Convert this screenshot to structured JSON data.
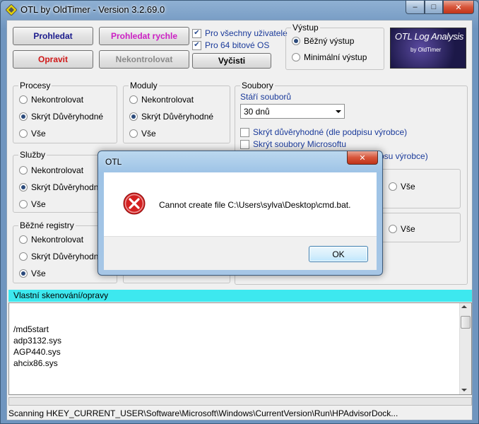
{
  "window": {
    "title": "OTL by OldTimer - Version 3.2.69.0",
    "minimize_glyph": "–",
    "maximize_glyph": "□",
    "close_glyph": "✕"
  },
  "toolbar": {
    "scan_label": "Prohledat",
    "quick_scan_label": "Prohledat rychle",
    "fix_label": "Opravit",
    "unchecked_label": "Nekontrolovat",
    "clear_label": "Vyčisti",
    "all_users_label": "Pro všechny uživatele",
    "bit64_label": "Pro 64 bitové OS"
  },
  "output": {
    "group_label": "Výstup",
    "standard_label": "Běžný výstup",
    "minimal_label": "Minimální výstup"
  },
  "logo": {
    "title": "OTL Log Analysis",
    "subtitle": "by OldTimer"
  },
  "groups": {
    "processes": {
      "label": "Procesy"
    },
    "modules": {
      "label": "Moduly"
    },
    "services": {
      "label": "Služby"
    },
    "registry": {
      "label": "Běžné registry"
    },
    "files": {
      "label": "Soubory"
    }
  },
  "options": {
    "unchecked": "Nekontrolovat",
    "hide_trusted": "Skrýt Důvěryhodné",
    "all": "Vše"
  },
  "files": {
    "age_label": "Stáří souborů",
    "age_value": "30 dnů",
    "hide_trusted_sig": "Skrýt důvěryhodné (dle podpisu výrobce)",
    "hide_microsoft": "Skrýt soubory Microsoftu",
    "partial_hidden_text": "psu výrobce)"
  },
  "custom_scan": {
    "header": "Vlastní skenování/opravy",
    "lines": [
      "/md5start",
      "adp3132.sys",
      "AGP440.sys",
      "ahcix86.sys"
    ]
  },
  "status_text": "Scanning HKEY_CURRENT_USER\\Software\\Microsoft\\Windows\\CurrentVersion\\Run\\HPAdvisorDock...",
  "dialog": {
    "title": "OTL",
    "message": "Cannot create file C:\\Users\\sylva\\Desktop\\cmd.bat.",
    "ok_label": "OK",
    "close_glyph": "✕"
  },
  "colors": {
    "scan_button_text": "#1a1a8c",
    "quick_scan_button_text": "#cc1fc4",
    "fix_button_text": "#d01818",
    "disabled_text": "#8a8a8a",
    "custom_scan_header_bg": "#3de8ef",
    "error_icon": "#d32020"
  },
  "icons": {
    "app": "otl-app-icon",
    "error": "error-x-icon",
    "combo": "chevron-down-icon"
  }
}
